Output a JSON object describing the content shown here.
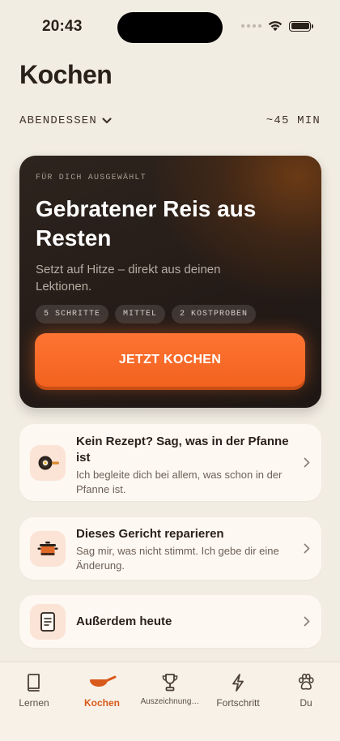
{
  "status": {
    "time": "20:43"
  },
  "page": {
    "title": "Kochen"
  },
  "meal": {
    "selected": "ABENDESSEN",
    "duration": "~45 MIN"
  },
  "hero": {
    "eyebrow": "FÜR DICH AUSGEWÄHLT",
    "title": "Gebratener Reis aus Resten",
    "subtitle": "Setzt auf Hitze – direkt aus deinen Lektionen.",
    "chips": [
      "5 SCHRITTE",
      "MITTEL",
      "2 KOSTPROBEN"
    ],
    "cta_label": "JETZT KOCHEN"
  },
  "cards": [
    {
      "title": "Kein Rezept? Sag, was in der Pfanne ist",
      "desc": "Ich begleite dich bei allem, was schon in der Pfanne ist.",
      "icon": "frying-pan-icon"
    },
    {
      "title": "Dieses Gericht reparieren",
      "desc": "Sag mir, was nicht stimmt. Ich gebe dir eine Änderung.",
      "icon": "pot-icon"
    },
    {
      "title": "Außerdem heute",
      "icon": "note-icon"
    }
  ],
  "tabs": [
    {
      "label": "Lernen",
      "icon": "book-icon"
    },
    {
      "label": "Kochen",
      "icon": "pan-icon",
      "active": true
    },
    {
      "label": "Auszeichnung…",
      "icon": "trophy-icon"
    },
    {
      "label": "Fortschritt",
      "icon": "bolt-icon"
    },
    {
      "label": "Du",
      "icon": "paw-icon"
    }
  ],
  "colors": {
    "accent": "#F26A2A",
    "background": "#F2EDE3",
    "hero_bg": "#2A211C"
  }
}
